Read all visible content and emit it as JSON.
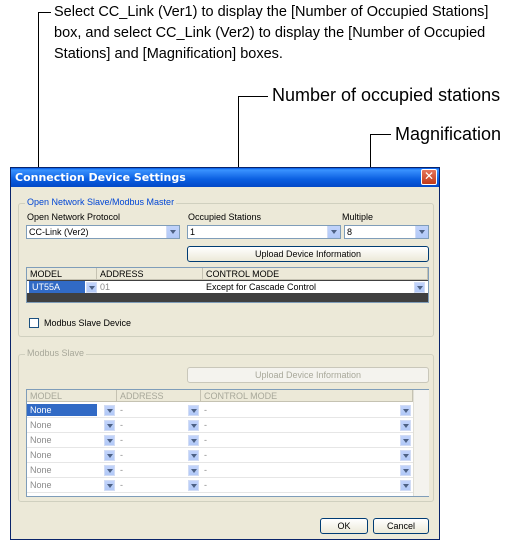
{
  "annotations": {
    "note1": "Select CC_Link (Ver1) to display the [Number of Occupied Stations] box, and select CC_Link (Ver2) to display the [Number of Occupied Stations] and [Magnification] boxes.",
    "note2": "Number of occupied stations",
    "note3": "Magnification",
    "marker_color": "#e8202a"
  },
  "dialog": {
    "title": "Connection Device Settings",
    "close": "✕",
    "open_network_group": {
      "title": "Open Network Slave/Modbus Master",
      "protocol_label": "Open Network Protocol",
      "protocol_value": "CC-Link (Ver2)",
      "occupied_label": "Occupied Stations",
      "occupied_value": "1",
      "magnification_label": "Multiple",
      "magnification_value": "8",
      "upload_button": "Upload Device Information",
      "columns": [
        "MODEL",
        "ADDRESS",
        "CONTROL MODE"
      ],
      "row": {
        "model": "UT55A",
        "address": "01",
        "control_mode": "Except for Cascade Control"
      },
      "modbus_checkbox": "Modbus Slave Device"
    },
    "modbus_group": {
      "title": "Modbus Slave",
      "upload_button": "Upload Device Information",
      "columns": [
        "MODEL",
        "ADDRESS",
        "CONTROL MODE"
      ],
      "rows": [
        {
          "model": "None",
          "address": "-",
          "mode": "-"
        },
        {
          "model": "None",
          "address": "-",
          "mode": "-"
        },
        {
          "model": "None",
          "address": "-",
          "mode": "-"
        },
        {
          "model": "None",
          "address": "-",
          "mode": "-"
        },
        {
          "model": "None",
          "address": "-",
          "mode": "-"
        },
        {
          "model": "None",
          "address": "-",
          "mode": "-"
        }
      ]
    },
    "ok_button": "OK",
    "cancel_button": "Cancel"
  }
}
